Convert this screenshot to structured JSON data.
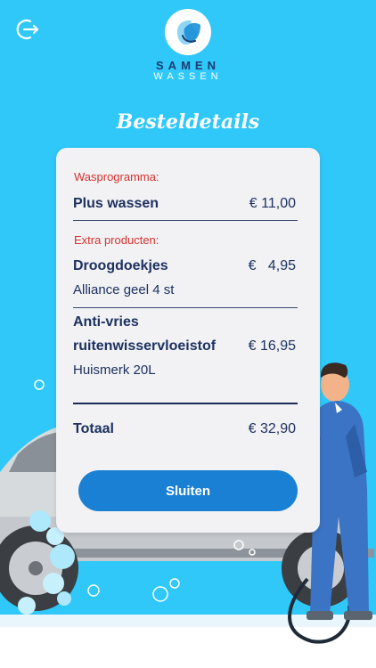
{
  "brand": {
    "line1": "SAMEN",
    "line2": "WASSEN",
    "icon": "logo-drop-icon",
    "colors": {
      "primary": "#1d3a72",
      "accent": "#2fc8f8",
      "button": "#1a80d4",
      "label": "#d8322e"
    }
  },
  "header": {
    "logout_icon": "logout-icon"
  },
  "title": "Besteldetails",
  "order": {
    "program_label": "Wasprogramma:",
    "program": {
      "name": "Plus wassen",
      "price": "€ 11,00"
    },
    "extras_label": "Extra producten:",
    "extras": [
      {
        "name": "Droogdoekjes",
        "price": "€   4,95",
        "sub": "Alliance geel 4 st"
      },
      {
        "name_line1": "Anti-vries",
        "name_line2": "ruitenwisservloeistof",
        "price": "€ 16,95",
        "sub": "Huismerk 20L"
      }
    ],
    "total_label": "Totaal",
    "total": "€ 32,90"
  },
  "close_label": "Sluiten"
}
